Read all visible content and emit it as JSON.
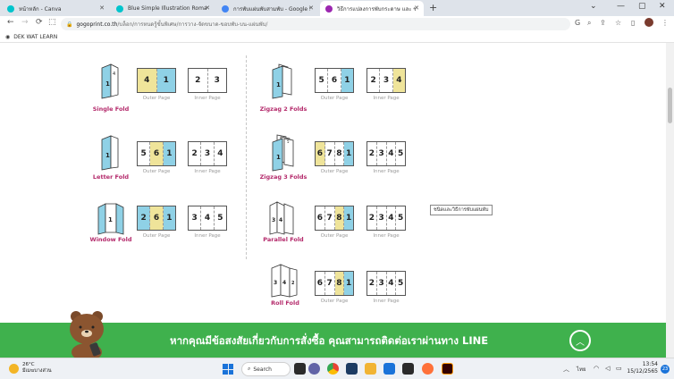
{
  "browser": {
    "tabs": [
      {
        "title": "หน้าหลัก - Canva",
        "color": "#00c4cc"
      },
      {
        "title": "Blue Simple Illustration Romance",
        "color": "#00c4cc"
      },
      {
        "title": "การพับแผ่นพับสามพับ - Google Search",
        "color": "#4285f4"
      },
      {
        "title": "วิธีการแปลงการพับกระดาษ และ ขนาดแผ่นพับ",
        "color": "#9c27b0"
      }
    ],
    "url_domain": "gogoprint.co.th",
    "url_path": "/บล็อก/การหนดรู้ขั้นพิเศษ/การวาง-จัดขนาด-ขอบพับ-บน-แผ่นพับ/",
    "bookmark": "DEK WAT LEARN",
    "window_controls": {
      "minimize": "—",
      "maximize": "▢",
      "close": "✕"
    }
  },
  "folds": [
    {
      "name": "Single Fold",
      "outer": [
        "4",
        "1"
      ],
      "outer_colors": [
        "yellow",
        "blue"
      ],
      "inner": [
        "2",
        "3"
      ],
      "inner_colors": [
        "",
        ""
      ]
    },
    {
      "name": "Letter Fold",
      "outer": [
        "5",
        "6",
        "1"
      ],
      "outer_colors": [
        "",
        "yellow",
        "blue"
      ],
      "inner": [
        "2",
        "3",
        "4"
      ],
      "inner_colors": [
        "",
        "",
        ""
      ]
    },
    {
      "name": "Window Fold",
      "outer": [
        "2",
        "6",
        "1"
      ],
      "outer_colors": [
        "blue",
        "yellow",
        "blue"
      ],
      "inner": [
        "3",
        "4",
        "5"
      ],
      "inner_colors": [
        "",
        "",
        ""
      ]
    },
    {
      "name": "Zigzag 2 Folds",
      "outer": [
        "5",
        "6",
        "1"
      ],
      "outer_colors": [
        "",
        "",
        "blue"
      ],
      "inner": [
        "2",
        "3",
        "4"
      ],
      "inner_colors": [
        "",
        "",
        "yellow"
      ]
    },
    {
      "name": "Zigzag 3 Folds",
      "outer": [
        "6",
        "7",
        "8",
        "1"
      ],
      "outer_colors": [
        "yellow",
        "",
        "",
        "blue"
      ],
      "inner": [
        "2",
        "3",
        "4",
        "5"
      ],
      "inner_colors": [
        "",
        "",
        "",
        ""
      ]
    },
    {
      "name": "Parallel Fold",
      "outer": [
        "6",
        "7",
        "8",
        "1"
      ],
      "outer_colors": [
        "",
        "",
        "yellow",
        "blue"
      ],
      "inner": [
        "2",
        "3",
        "4",
        "5"
      ],
      "inner_colors": [
        "",
        "",
        "",
        ""
      ]
    },
    {
      "name": "Roll Fold",
      "outer": [
        "6",
        "7",
        "8",
        "1"
      ],
      "outer_colors": [
        "",
        "",
        "yellow",
        "blue"
      ],
      "inner": [
        "2",
        "3",
        "4",
        "5"
      ],
      "inner_colors": [
        "",
        "",
        "",
        ""
      ]
    }
  ],
  "labels": {
    "outer": "Outer Page",
    "inner": "Inner Page"
  },
  "tooltip": "ชนิดและวิธีการพับแผ่นพับ",
  "banner": {
    "text": "หากคุณมีข้อสงสัยเกี่ยวกับการสั่งซื้อ คุณสามารถติดต่อเราผ่านทาง LINE",
    "color": "#3fb14d"
  },
  "taskbar": {
    "weather_temp": "26°C",
    "weather_desc": "มีเมฆบางส่วน",
    "search_label": "Search",
    "time": "13:54",
    "date": "15/12/2565",
    "lang": "ไทย",
    "notifications": "23"
  },
  "colors": {
    "blue": "#8fd1e6",
    "yellow": "#efe49a",
    "fold_name": "#b42a6b"
  }
}
